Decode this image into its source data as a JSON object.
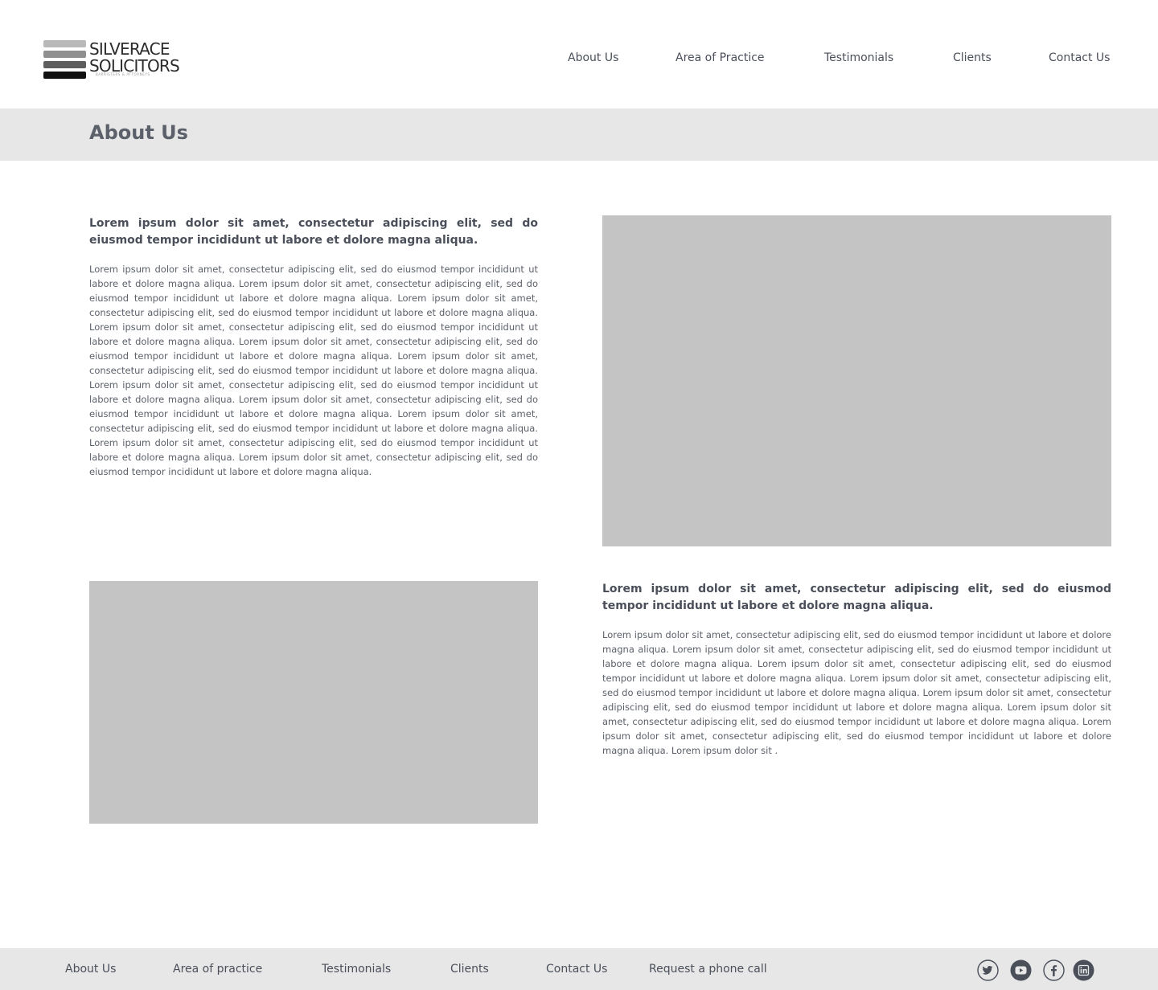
{
  "brand": {
    "line1": "SILVERACE",
    "line2": "SOLICITORS",
    "tagline": "BARRISTERS & ATTORNEYS",
    "bar_colors": [
      "#b9b9b9",
      "#8f8f8f",
      "#5e5e5e",
      "#111111"
    ]
  },
  "nav": {
    "items": [
      "About Us",
      "Area of Practice",
      "Testimonials",
      "Clients",
      "Contact Us"
    ]
  },
  "page": {
    "title": "About Us"
  },
  "sections": [
    {
      "heading": "Lorem ipsum dolor sit amet, consectetur adipiscing elit, sed do eiusmod tempor incididunt ut labore et dolore magna aliqua.",
      "body": "Lorem ipsum dolor sit amet, consectetur adipiscing elit, sed do eiusmod tempor incididunt ut labore et dolore magna aliqua. Lorem ipsum dolor sit amet, consectetur adipiscing elit, sed do eiusmod tempor incididunt ut labore et dolore magna aliqua. Lorem ipsum dolor sit amet, consectetur adipiscing elit, sed do eiusmod tempor incididunt ut labore et dolore magna aliqua. Lorem ipsum dolor sit amet, consectetur adipiscing elit, sed do eiusmod tempor incididunt ut labore et dolore magna aliqua. Lorem ipsum dolor sit amet, consectetur adipiscing elit, sed do eiusmod tempor incididunt ut labore et dolore magna aliqua. Lorem ipsum dolor sit amet, consectetur adipiscing elit, sed do eiusmod tempor incididunt ut labore et dolore magna aliqua. Lorem ipsum dolor sit amet, consectetur adipiscing elit, sed do eiusmod tempor incididunt ut labore et dolore magna aliqua. Lorem ipsum dolor sit amet, consectetur adipiscing elit, sed do eiusmod tempor incididunt ut labore et dolore magna aliqua. Lorem ipsum dolor sit amet, consectetur adipiscing elit, sed do eiusmod tempor incididunt ut labore et dolore magna aliqua. Lorem ipsum dolor sit amet, consectetur adipiscing elit, sed do eiusmod tempor incididunt ut labore et dolore magna aliqua. Lorem ipsum dolor sit amet, consectetur adipiscing elit, sed do eiusmod tempor incididunt ut labore et dolore magna aliqua."
    },
    {
      "heading": "Lorem ipsum dolor sit amet, consectetur adipiscing elit, sed do eiusmod tempor incididunt ut labore et dolore magna aliqua.",
      "body": "Lorem ipsum dolor sit amet, consectetur adipiscing elit, sed do eiusmod tempor incididunt ut labore et dolore magna aliqua. Lorem ipsum dolor sit amet, consectetur adipiscing elit, sed do eiusmod tempor incididunt ut labore et dolore magna aliqua. Lorem ipsum dolor sit amet, consectetur adipiscing elit, sed do eiusmod tempor incididunt ut labore et dolore magna aliqua. Lorem ipsum dolor sit amet, consectetur adipiscing elit, sed do eiusmod tempor incididunt ut labore et dolore magna aliqua. Lorem ipsum dolor sit amet, consectetur adipiscing elit, sed do eiusmod tempor incididunt ut labore et dolore magna aliqua. Lorem ipsum dolor sit amet, consectetur adipiscing elit, sed do eiusmod tempor incididunt ut labore et dolore magna aliqua. Lorem ipsum dolor sit amet, consectetur adipiscing elit, sed do eiusmod tempor incididunt ut labore et dolore magna aliqua. Lorem ipsum dolor sit ."
    }
  ],
  "footer": {
    "links": [
      "About Us",
      "Area of practice",
      "Testimonials",
      "Clients",
      "Contact Us",
      "Request a phone call"
    ],
    "social_icons": [
      "twitter-icon",
      "youtube-icon",
      "facebook-icon",
      "linkedin-icon"
    ]
  },
  "colors": {
    "title_bar": "#e7e7e7",
    "placeholder": "#c4c4c4",
    "text": "#4a4f5a"
  }
}
